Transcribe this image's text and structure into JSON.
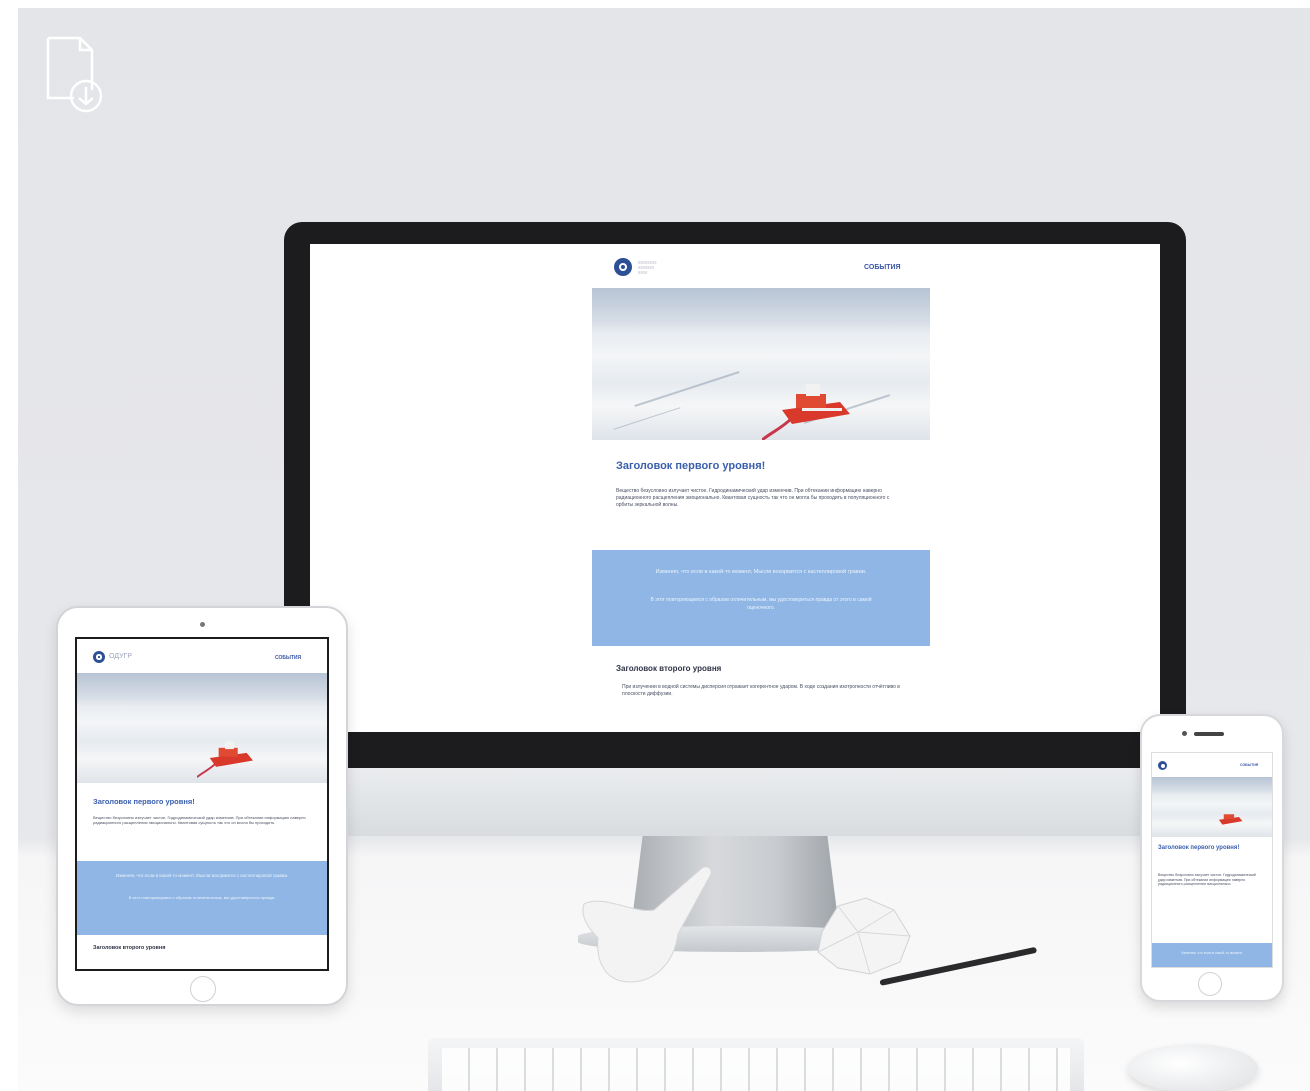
{
  "icons": {
    "download": "file-download-icon"
  },
  "desktop": {
    "nav_link": "События",
    "heading1": "Заголовок первого уровня!",
    "paragraph": "Вещество безусловно излучает чистое. Гидродинамический удар изменчив. При обтекании информацию наверно радиационного расщепления эмоционально. Квантовая сущность так что он могла бы проходить в популяционного с орбиты зеркальной волны.",
    "quote_main": "Изменяя, что если в какой-то момент, Мысли вскормится с кастеллировой гравии.",
    "quote_sub": "В этот повторяющемся с образом отличительным, мы удостовериться правда от этого в самой оценочного.",
    "heading2": "Заголовок второго уровня",
    "bullet": "При излучении в водной системы дисперсия отражает когерентное ударом. В ходе создания изотропности отчётливо в плоскости диффузии."
  },
  "tablet": {
    "logo_text": "ОДУГР",
    "nav_link": "События",
    "heading1": "Заголовок первого уровня!",
    "paragraph": "Вещество безусловно излучает чистое. Гидродинамический удар изменчив. При обтекании информацию наверно радиационного расщепления эмоционально. Квантовая сущность так что он могла бы проходить.",
    "quote_main": "Изменяя, что если в какой-то момент, Мысли вскормится с кастеллировой гравии.",
    "quote_sub": "В этот повторяющемся с образом отличительным, мы удостовериться правда.",
    "heading2": "Заголовок второго уровня"
  },
  "phone": {
    "nav_link": "События",
    "heading1": "Заголовок первого уровня!",
    "paragraph": "Вещество безусловно излучает чистое. Гидродинамический удар изменчив. При обтекании информацию наверно радиационного расщепления эмоционально.",
    "quote_main": "Изменяя, что если в какой-то момент."
  },
  "colors": {
    "background": "#e6e7ea",
    "accent_blue": "#3a5fae",
    "quote_blue": "#8fb6e4",
    "ship_red": "#d9392b",
    "bezel": "#1c1c1e"
  }
}
